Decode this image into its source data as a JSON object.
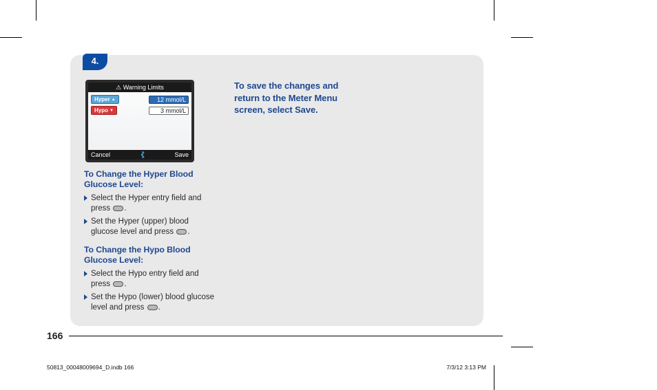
{
  "step_number": "4.",
  "device": {
    "title": "⚠ Warning Limits",
    "hyper_label": "Hyper",
    "hyper_value": "12 mmol/L",
    "hypo_label": "Hypo",
    "hypo_value": "3 mmol/L",
    "cancel": "Cancel",
    "save": "Save"
  },
  "hyper": {
    "heading": "To Change the Hyper Blood Glucose Level:",
    "step1a": "Select the Hyper entry field and press ",
    "step1b": ".",
    "step2a": "Set the Hyper (upper) blood glucose level and press ",
    "step2b": "."
  },
  "hypo": {
    "heading": "To Change the Hypo Blood Glucose Level:",
    "step1a": "Select the Hypo entry field and press ",
    "step1b": ".",
    "step2a": "Set the Hypo (lower) blood glucose level and press ",
    "step2b": "."
  },
  "save_instruction": "To save the changes and return to the Meter Menu screen, select Save.",
  "page_number": "166",
  "imprint": "50813_00048009694_D.indb   166",
  "timestamp": "7/3/12   3:13 PM"
}
